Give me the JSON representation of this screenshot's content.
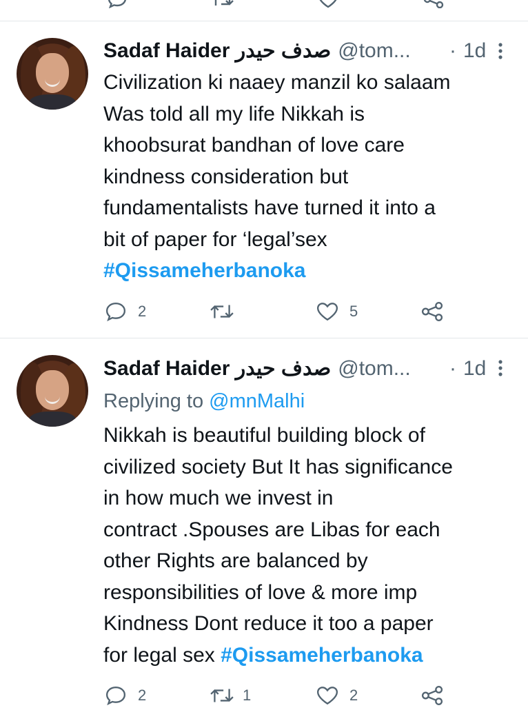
{
  "tweets": [
    {
      "display_name": "Sadaf Haider صدف حیدر",
      "handle": "@tom...",
      "separator": "·",
      "time": "1d",
      "lines": [
        "Civilization ki naaey manzil ko salaam",
        "Was told all my life Nikkah is",
        "khoobsurat bandhan of love care",
        "kindness consideration but",
        "fundamentalists have turned it into a",
        "bit of paper for ‘legal’sex"
      ],
      "hashtag": "#Qissameherbanoka",
      "replies": "2",
      "retweets": "",
      "likes": "5"
    },
    {
      "display_name": "Sadaf Haider صدف حیدر",
      "handle": "@tom...",
      "separator": "·",
      "time": "1d",
      "replying_prefix": "Replying to",
      "replying_to": "@mnMalhi",
      "lines": [
        "Nikkah is beautiful building block of",
        "civilized society But It has significance",
        "in how much we invest in",
        "contract .Spouses are Libas for each",
        "other Rights are balanced by",
        "responsibilities of love & more imp",
        "Kindness Dont reduce it too a paper",
        "for legal sex"
      ],
      "hashtag": "#Qissameherbanoka",
      "replies": "2",
      "retweets": "1",
      "likes": "2"
    }
  ],
  "colors": {
    "text": "#0f1419",
    "secondary": "#536471",
    "accent": "#1d9bf0",
    "divider": "#e3e6e9"
  },
  "icons": [
    "reply-icon",
    "retweet-icon",
    "like-icon",
    "share-icon",
    "more-icon"
  ]
}
